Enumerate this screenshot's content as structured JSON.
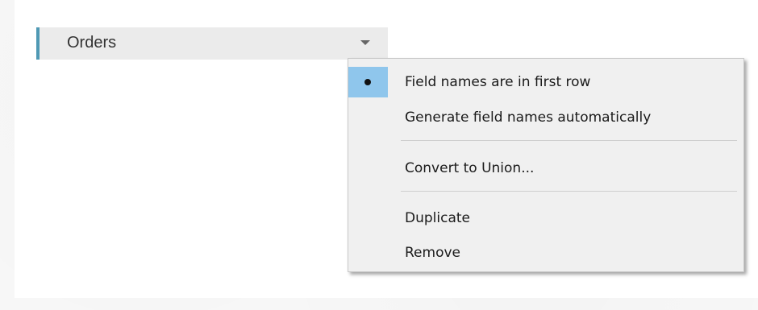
{
  "table": {
    "name": "Orders",
    "accent_color": "#4f99b4",
    "dropdown_icon": "caret-down-icon"
  },
  "menu": {
    "items": [
      {
        "label": "Field names are in first row",
        "selected": true,
        "marker_icon": "bullet-icon"
      },
      {
        "label": "Generate field names automatically",
        "selected": false
      },
      {
        "label": "Convert to Union...",
        "selected": false
      },
      {
        "label": "Duplicate",
        "selected": false
      },
      {
        "label": "Remove",
        "selected": false
      }
    ],
    "selection_color": "#8fc6ec"
  }
}
